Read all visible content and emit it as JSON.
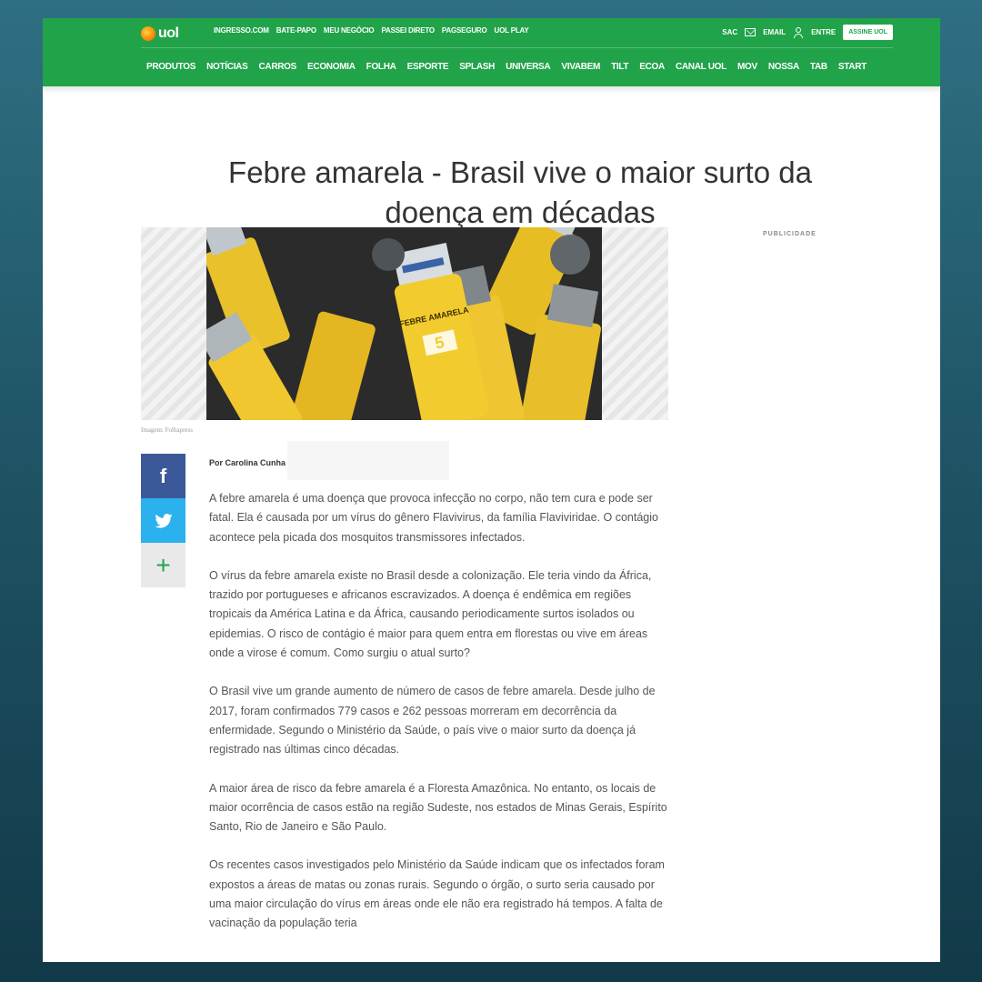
{
  "header": {
    "logo_text": "uol",
    "top_links": [
      "INGRESSO.COM",
      "BATE-PAPO",
      "MEU NEGÓCIO",
      "PASSEI DIRETO",
      "PAGSEGURO",
      "UOL PLAY"
    ],
    "sac": "SAC",
    "email": "EMAIL",
    "entre": "ENTRE",
    "assine": "ASSINE UOL",
    "nav": [
      "PRODUTOS",
      "NOTÍCIAS",
      "CARROS",
      "ECONOMIA",
      "FOLHA",
      "ESPORTE",
      "SPLASH",
      "UNIVERSA",
      "VIVABEM",
      "TILT",
      "ECOA",
      "CANAL UOL",
      "MOV",
      "NOSSA",
      "TAB",
      "START"
    ]
  },
  "article": {
    "title": "Febre amarela - Brasil vive o maior surto da doença em décadas",
    "publicidade": "PUBLICIDADE",
    "image_credit": "Imagem: Folhapress",
    "author": "Por Carolina Cunha",
    "paragraphs": [
      "A febre amarela é uma doença que provoca infecção no corpo, não tem cura e pode ser fatal. Ela é causada por um vírus do gênero Flavivirus, da família Flaviviridae. O contágio acontece pela picada dos mosquitos transmissores infectados.",
      "O vírus da febre amarela existe no Brasil desde a colonização. Ele teria vindo da África, trazido por portugueses e africanos escravizados. A doença é endêmica em regiões tropicais da América Latina e da África, causando periodicamente surtos isolados ou epidemias. O risco de contágio é maior para quem entra em florestas ou vive em áreas onde a virose é comum. Como surgiu o atual surto?",
      "O Brasil vive um grande aumento de número de casos de febre amarela. Desde julho de 2017, foram confirmados 779 casos e 262 pessoas morreram em decorrência da enfermidade. Segundo o Ministério da Saúde, o país vive o maior surto da doença já registrado nas últimas cinco décadas.",
      "A maior área de risco da febre amarela é a Floresta Amazônica. No entanto, os locais de maior ocorrência de casos estão na região Sudeste, nos estados de Minas Gerais, Espírito Santo, Rio de Janeiro e São Paulo.",
      "Os recentes casos investigados pelo Ministério da Saúde indicam que os infectados foram expostos a áreas de matas ou zonas rurais. Segundo o órgão, o surto seria causado por uma maior circulação do vírus em áreas onde ele não era registrado há tempos. A falta de vacinação da população teria"
    ]
  },
  "photo_vial_label": "FEBRE AMARELA",
  "colors": {
    "brand_green": "#21a34a",
    "facebook": "#3b5998",
    "twitter": "#2ab1ee"
  }
}
